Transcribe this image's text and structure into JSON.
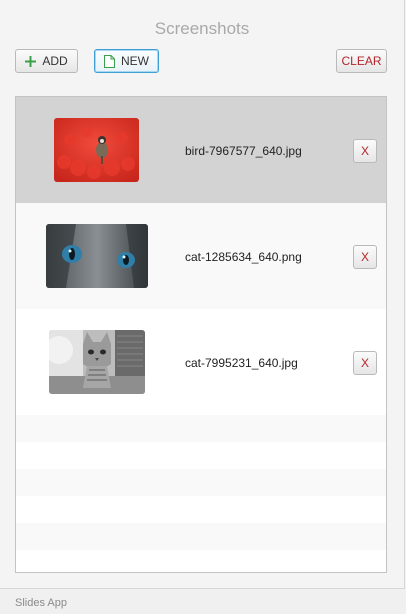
{
  "window": {
    "title": "Screenshots"
  },
  "toolbar": {
    "add_label": "ADD",
    "new_label": "NEW",
    "clear_label": "CLEAR"
  },
  "list": {
    "items": [
      {
        "filename": "bird-7967577_640.jpg",
        "remove_label": "X",
        "selected": true
      },
      {
        "filename": "cat-1285634_640.png",
        "remove_label": "X",
        "selected": false
      },
      {
        "filename": "cat-7995231_640.jpg",
        "remove_label": "X",
        "selected": false
      }
    ]
  },
  "status": {
    "app_name": "Slides App"
  },
  "colors": {
    "selection": "#d3d3d3",
    "accent_focus": "#3d9fd4",
    "danger_text": "#b3262a",
    "add_icon": "#3aa04a"
  }
}
